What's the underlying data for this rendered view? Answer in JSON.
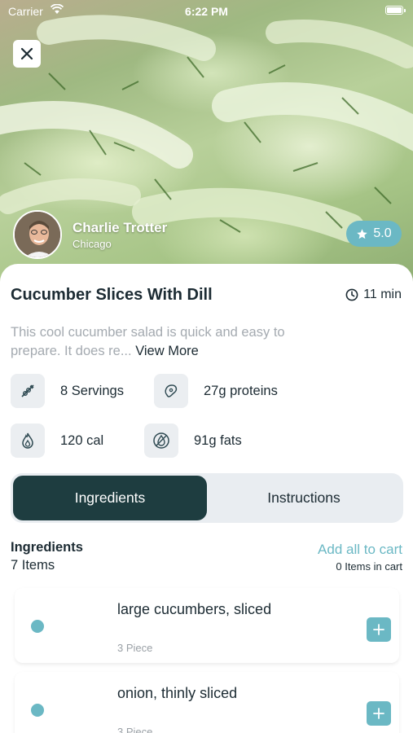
{
  "status_bar": {
    "carrier": "Carrier",
    "time": "6:22 PM"
  },
  "chef": {
    "name": "Charlie Trotter",
    "city": "Chicago"
  },
  "rating": "5.0",
  "recipe": {
    "title": "Cucumber Slices With Dill",
    "time": "11 min",
    "description": "This cool cucumber salad is quick and easy to prepare. It does re...",
    "view_more": "View More"
  },
  "nutrition": [
    {
      "icon": "servings-icon",
      "label": "8 Servings"
    },
    {
      "icon": "protein-icon",
      "label": "27g proteins"
    },
    {
      "icon": "calories-icon",
      "label": "120 cal"
    },
    {
      "icon": "fats-icon",
      "label": "91g fats"
    }
  ],
  "tabs": {
    "ingredients": "Ingredients",
    "instructions": "Instructions",
    "active": "Ingredients"
  },
  "ingredients": {
    "title": "Ingredients",
    "count": "7 Items",
    "add_all": "Add all to cart",
    "cart_count": "0 Items in cart",
    "items": [
      {
        "name": "large cucumbers, sliced",
        "qty": "3 Piece"
      },
      {
        "name": "onion, thinly sliced",
        "qty": "3 Piece"
      }
    ]
  },
  "colors": {
    "accent": "#6bb8c4",
    "dark": "#1e3d40",
    "text": "#1c2b33",
    "muted": "#a4aab0"
  }
}
